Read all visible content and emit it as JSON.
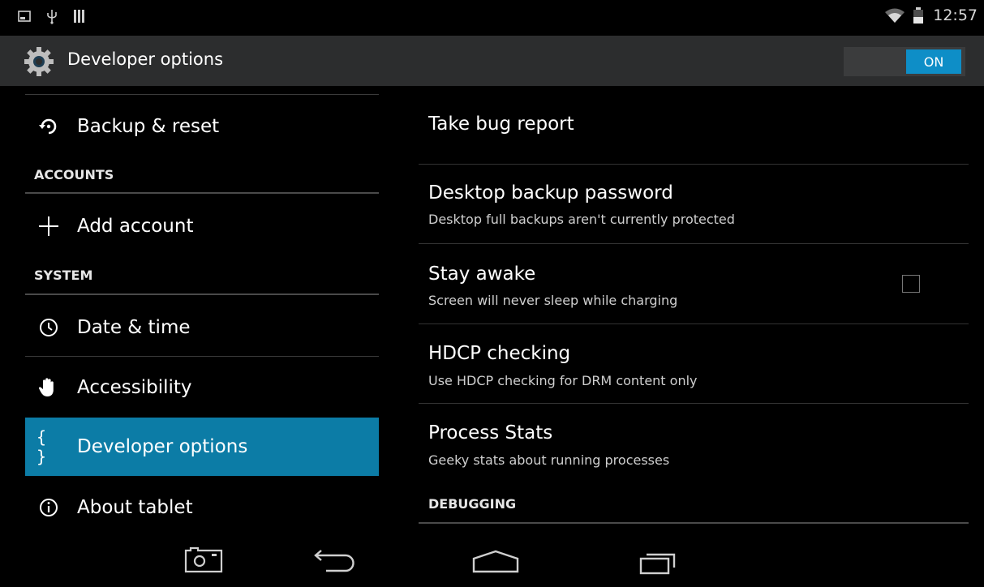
{
  "status_bar": {
    "time": "12:57",
    "icons_left": [
      "screenshot-icon",
      "usb-icon",
      "storage-icon"
    ],
    "icons_right": [
      "wifi-icon",
      "battery-charging-icon"
    ]
  },
  "action_bar": {
    "title": "Developer options",
    "icon": "settings-gear-icon",
    "toggle_label": "ON",
    "toggle_color": "#0e8ec7"
  },
  "left_panel": {
    "items": [
      {
        "label": "Backup & reset",
        "icon": "backup-restore-icon"
      },
      {
        "label": "Add account",
        "icon": "plus-icon"
      },
      {
        "label": "Date & time",
        "icon": "clock-icon"
      },
      {
        "label": "Accessibility",
        "icon": "hand-icon"
      },
      {
        "label": "Developer options",
        "icon": "braces-icon",
        "selected": true
      },
      {
        "label": "About tablet",
        "icon": "info-icon"
      }
    ],
    "headers": {
      "accounts": "ACCOUNTS",
      "system": "SYSTEM"
    },
    "selected_color": "#0c7ca6"
  },
  "right_panel": {
    "items": [
      {
        "title": "Take bug report"
      },
      {
        "title": "Desktop backup password",
        "subtitle": "Desktop full backups aren't currently protected"
      },
      {
        "title": "Stay awake",
        "subtitle": "Screen will never sleep while charging",
        "checked": false
      },
      {
        "title": "HDCP checking",
        "subtitle": "Use HDCP checking for DRM content only"
      },
      {
        "title": "Process Stats",
        "subtitle": "Geeky stats about running processes"
      }
    ],
    "section_header": "DEBUGGING"
  },
  "nav_bar": {
    "buttons": [
      "screenshot-button",
      "back-button",
      "home-button",
      "recents-button"
    ]
  }
}
